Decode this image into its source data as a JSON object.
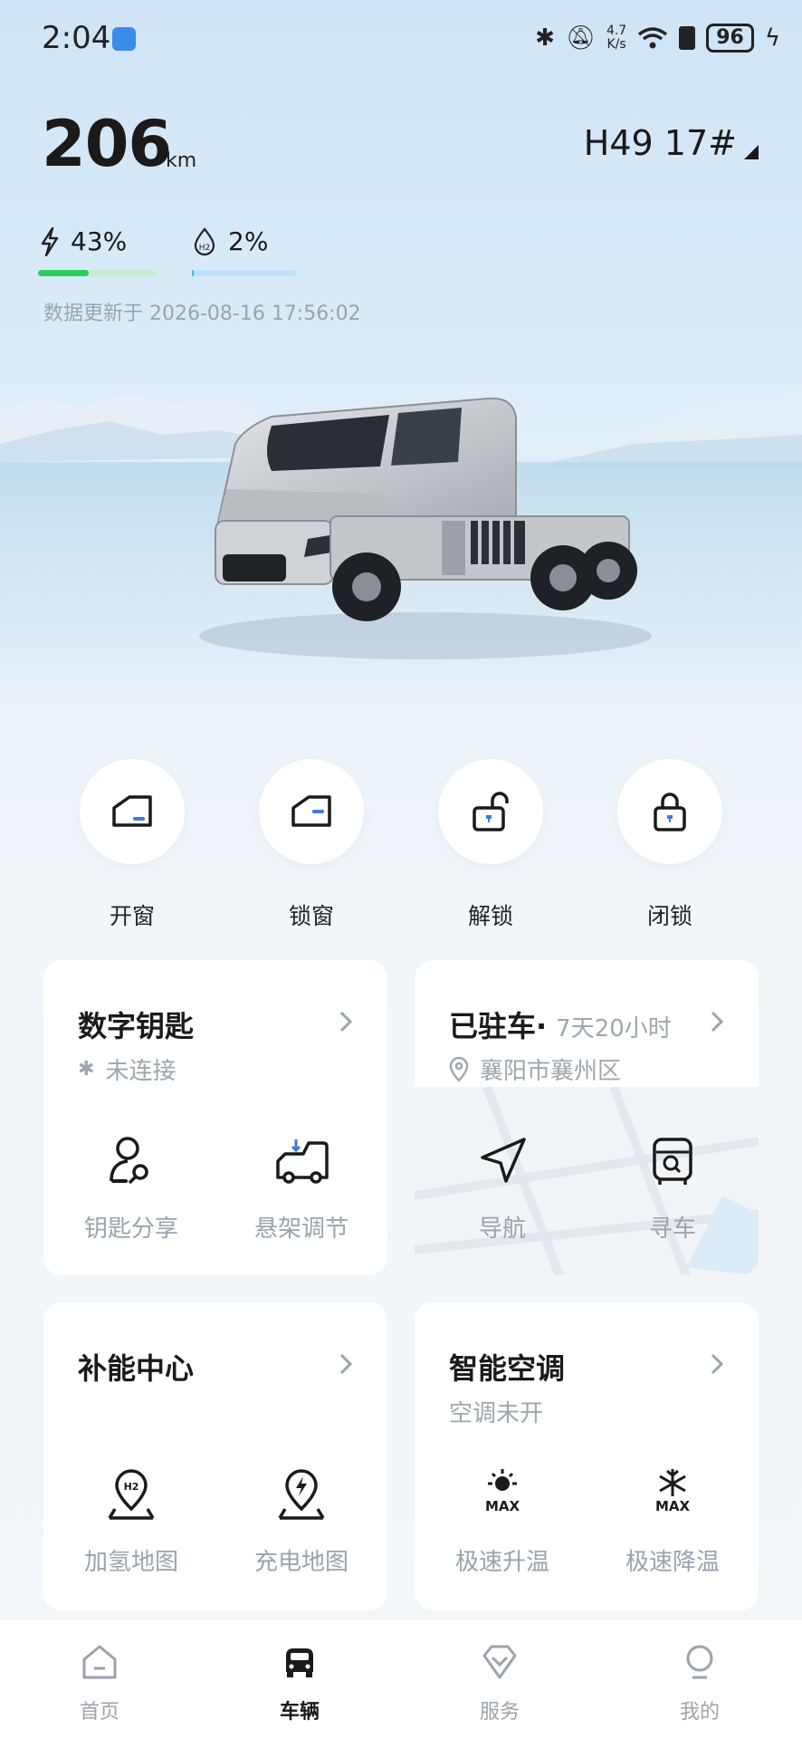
{
  "status_bar": {
    "time": "2:04",
    "net_speed_value": "4.7",
    "net_speed_unit": "K/s",
    "battery": "96"
  },
  "vehicle": {
    "range_value": "206",
    "range_unit": "km",
    "plate": "H49 17#",
    "electric_percent": "43%",
    "electric_level": 0.43,
    "hydrogen_percent": "2%",
    "hydrogen_level": 0.02,
    "update_time": "数据更新于 2026-08-16 17:56:02"
  },
  "controls": [
    {
      "label": "开窗",
      "icon": "window-open-icon"
    },
    {
      "label": "锁窗",
      "icon": "window-lock-icon"
    },
    {
      "label": "解锁",
      "icon": "unlock-icon"
    },
    {
      "label": "闭锁",
      "icon": "lock-icon"
    }
  ],
  "cards": {
    "digital_key": {
      "title": "数字钥匙",
      "status": "未连接",
      "actions": [
        {
          "label": "钥匙分享",
          "icon": "key-share-icon"
        },
        {
          "label": "悬架调节",
          "icon": "suspension-icon"
        }
      ]
    },
    "parking": {
      "title": "已驻车·",
      "duration": "7天20小时",
      "location": "襄阳市襄州区",
      "actions": [
        {
          "label": "导航",
          "icon": "navigation-icon"
        },
        {
          "label": "寻车",
          "icon": "find-car-icon"
        }
      ]
    },
    "energy": {
      "title": "补能中心",
      "actions": [
        {
          "label": "加氢地图",
          "icon": "hydrogen-map-icon"
        },
        {
          "label": "充电地图",
          "icon": "charging-map-icon"
        }
      ]
    },
    "climate": {
      "title": "智能空调",
      "status": "空调未开",
      "actions": [
        {
          "label": "极速升温",
          "icon": "max-heat-icon",
          "badge": "MAX"
        },
        {
          "label": "极速降温",
          "icon": "max-cool-icon",
          "badge": "MAX"
        }
      ]
    }
  },
  "bottom_nav": [
    {
      "label": "首页",
      "icon": "home-icon",
      "active": false
    },
    {
      "label": "车辆",
      "icon": "vehicle-icon",
      "active": true
    },
    {
      "label": "服务",
      "icon": "service-icon",
      "active": false
    },
    {
      "label": "我的",
      "icon": "profile-icon",
      "active": false
    }
  ],
  "colors": {
    "electric": "#2ecc5a",
    "hydrogen": "#4ab0ea",
    "accent_blue": "#3d7bd9"
  }
}
